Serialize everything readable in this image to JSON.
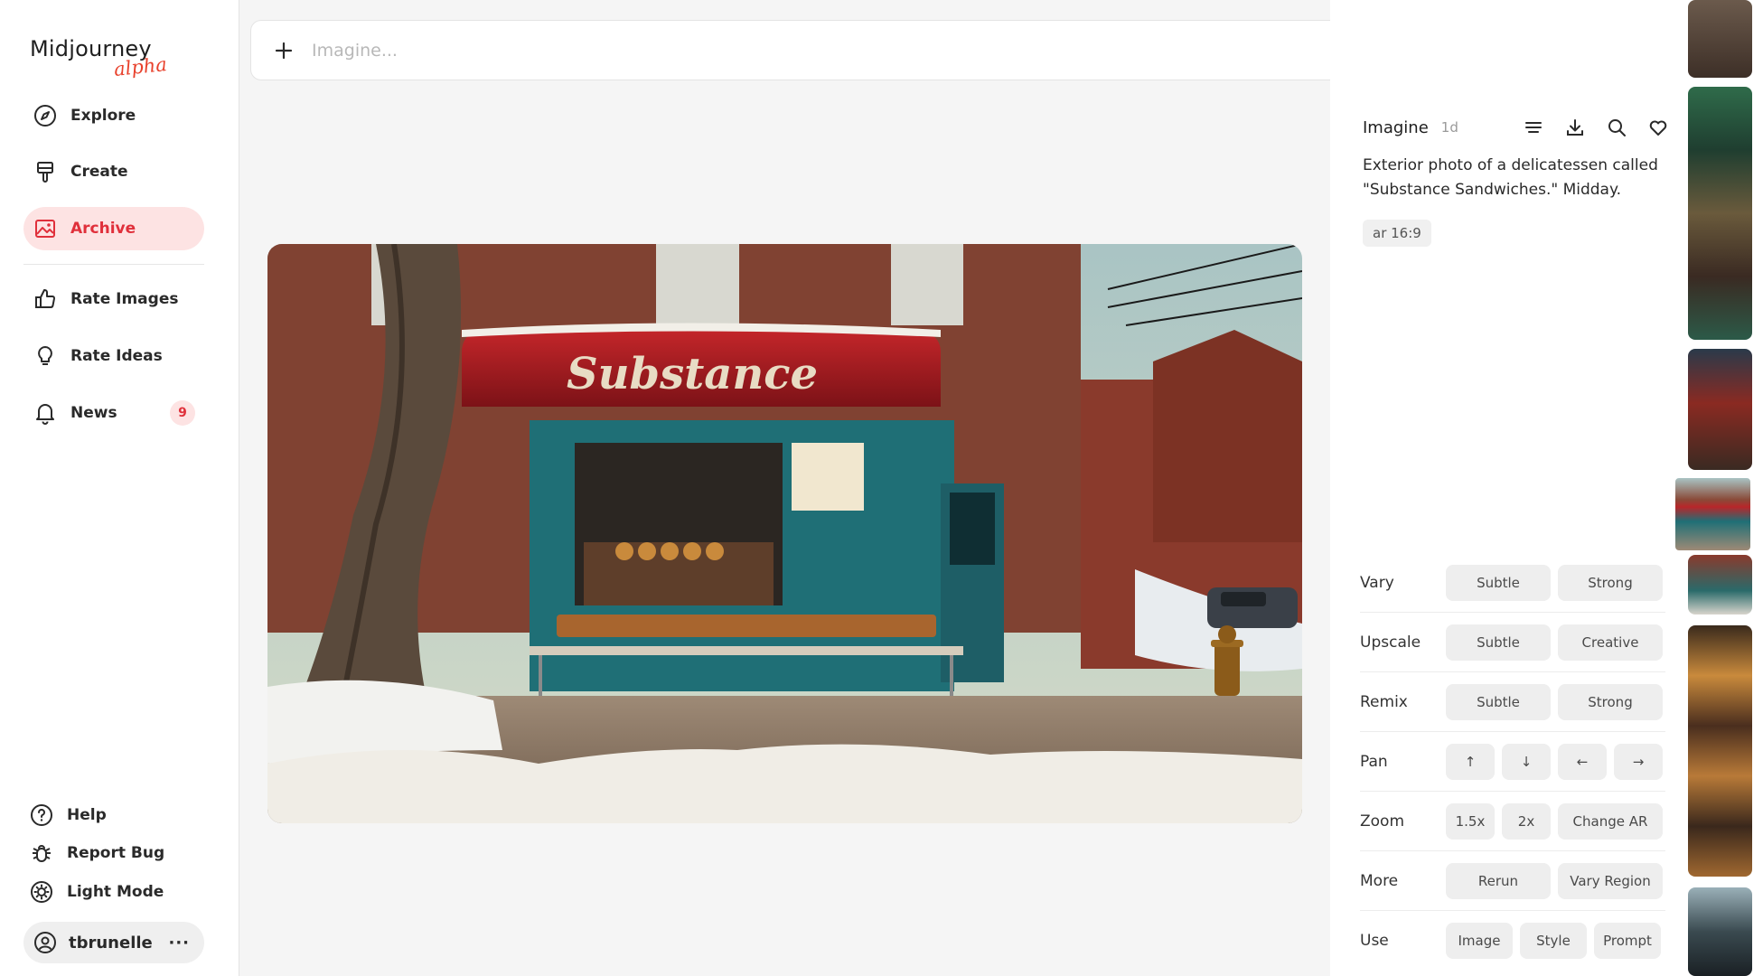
{
  "brand": {
    "name": "Midjourney",
    "tag": "alpha",
    "accent": "#e0303b"
  },
  "nav": [
    {
      "label": "Explore",
      "icon": "compass-icon"
    },
    {
      "label": "Create",
      "icon": "brush-icon"
    },
    {
      "label": "Archive",
      "icon": "image-icon",
      "active": true
    },
    {
      "label": "Rate Images",
      "icon": "thumbs-up-icon"
    },
    {
      "label": "Rate Ideas",
      "icon": "lightbulb-icon"
    },
    {
      "label": "News",
      "icon": "bell-icon",
      "badge": "9"
    }
  ],
  "bottom_nav": [
    {
      "label": "Help",
      "icon": "help-icon"
    },
    {
      "label": "Report Bug",
      "icon": "bug-icon"
    },
    {
      "label": "Light Mode",
      "icon": "sun-icon"
    }
  ],
  "user": {
    "name": "tbrunelle",
    "more": "···"
  },
  "search": {
    "placeholder": "Imagine..."
  },
  "image": {
    "sign_text": "Substance"
  },
  "panel": {
    "title": "Imagine",
    "age": "1d",
    "prompt": "Exterior photo of a delicatessen called \"Substance Sandwiches.\" Midday.",
    "param": "ar 16:9",
    "actions": [
      {
        "label": "Vary",
        "buttons": [
          "Subtle",
          "Strong"
        ]
      },
      {
        "label": "Upscale",
        "buttons": [
          "Subtle",
          "Creative"
        ]
      },
      {
        "label": "Remix",
        "buttons": [
          "Subtle",
          "Strong"
        ]
      },
      {
        "label": "Pan",
        "buttons": [
          "↑",
          "↓",
          "←",
          "→"
        ]
      },
      {
        "label": "Zoom",
        "buttons": [
          "1.5x",
          "2x",
          "Change AR"
        ]
      },
      {
        "label": "More",
        "buttons": [
          "Rerun",
          "Vary Region"
        ]
      },
      {
        "label": "Use",
        "buttons": [
          "Image",
          "Style",
          "Prompt"
        ]
      }
    ]
  }
}
